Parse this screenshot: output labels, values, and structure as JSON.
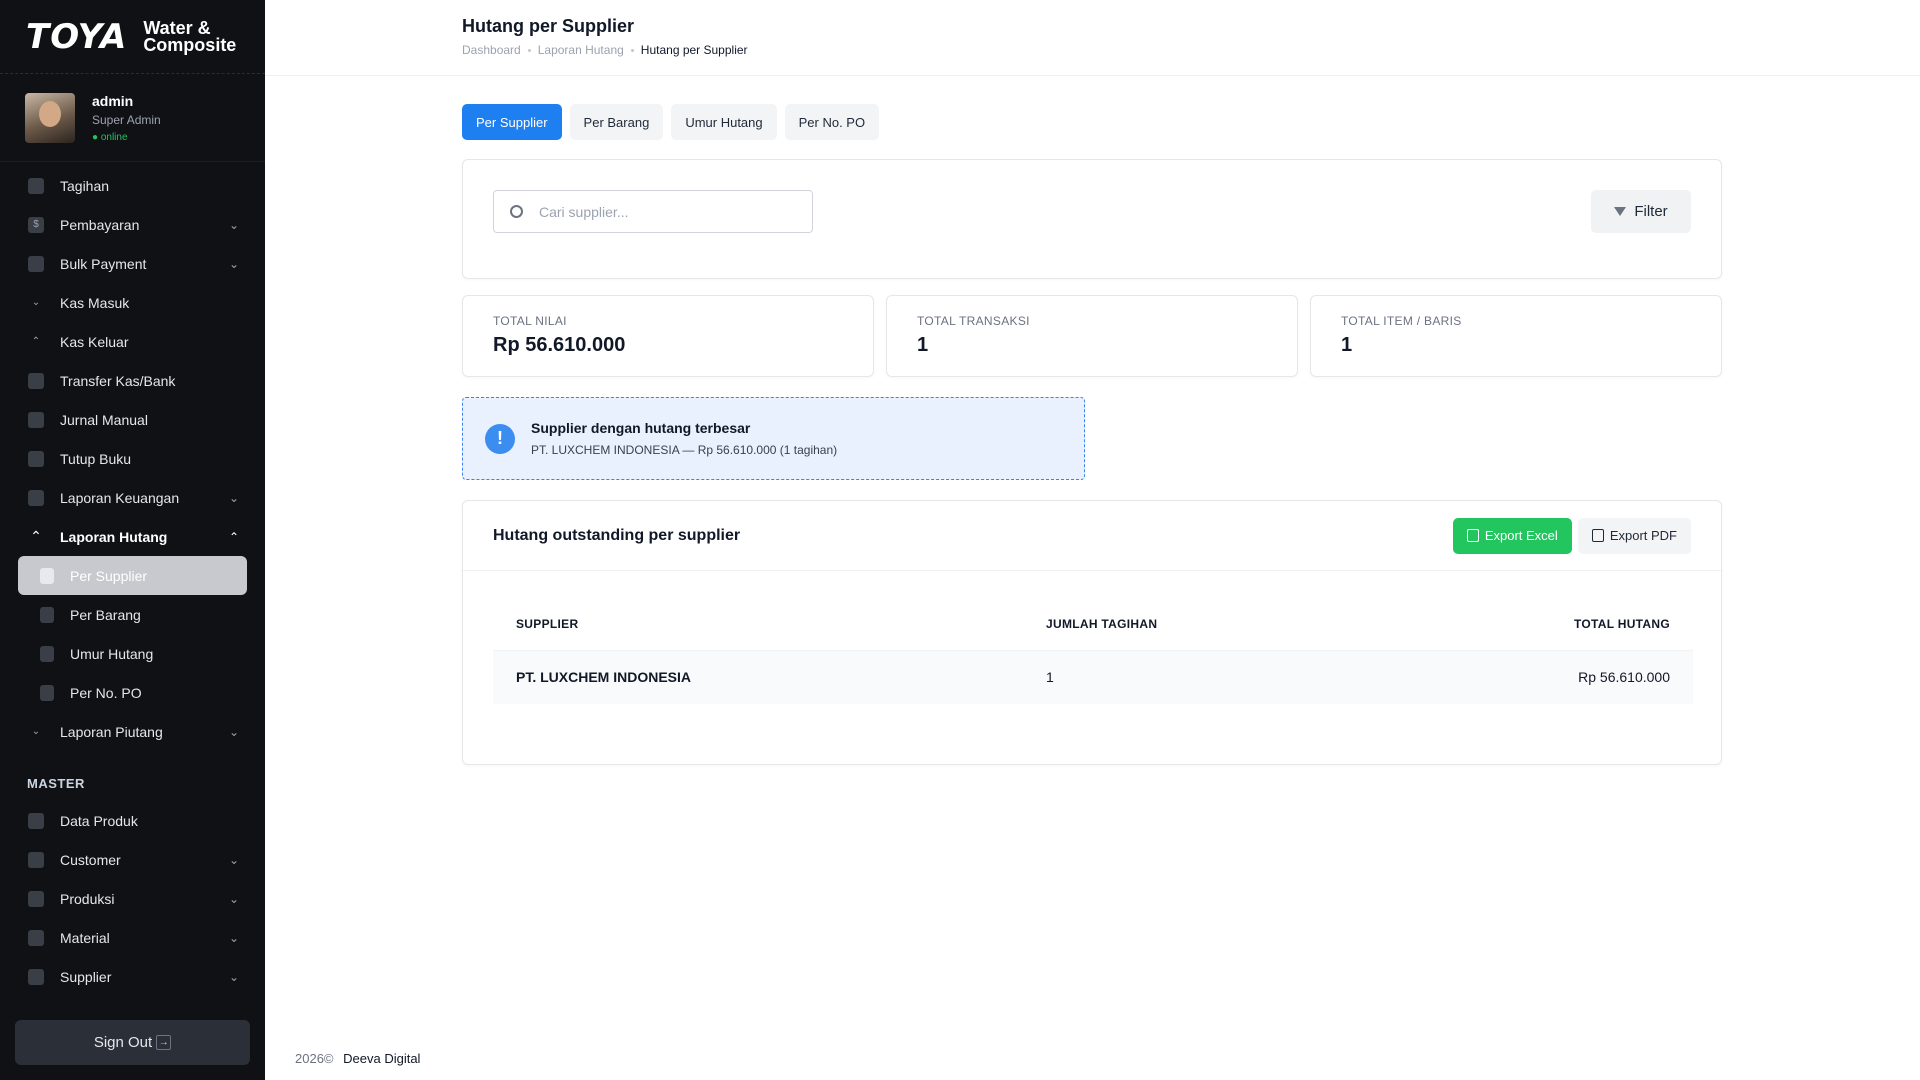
{
  "brand": {
    "logo": "TOYA",
    "line1": "Water &",
    "line2": "Composite"
  },
  "user": {
    "name": "admin",
    "role": "Super Admin",
    "status": "● online"
  },
  "sidebar": {
    "items": [
      {
        "label": "Tagihan",
        "chevron": ""
      },
      {
        "label": "Pembayaran",
        "chevron": "⌄"
      },
      {
        "label": "Bulk Payment",
        "chevron": "⌄"
      },
      {
        "label": "Kas Masuk",
        "chevron": ""
      },
      {
        "label": "Kas Keluar",
        "chevron": ""
      },
      {
        "label": "Transfer Kas/Bank",
        "chevron": ""
      },
      {
        "label": "Jurnal Manual",
        "chevron": ""
      },
      {
        "label": "Tutup Buku",
        "chevron": ""
      },
      {
        "label": "Laporan Keuangan",
        "chevron": "⌄"
      }
    ],
    "open_group": {
      "label": "Laporan Hutang",
      "chevron": "⌃"
    },
    "sub_items": [
      "Per Supplier",
      "Per Barang",
      "Umur Hutang",
      "Per No. PO"
    ],
    "after_items": [
      {
        "label": "Laporan Piutang",
        "chevron": "⌄"
      }
    ],
    "section_master": "MASTER",
    "master_items": [
      {
        "label": "Data Produk",
        "chevron": ""
      },
      {
        "label": "Customer",
        "chevron": "⌄"
      },
      {
        "label": "Produksi",
        "chevron": "⌄"
      },
      {
        "label": "Material",
        "chevron": "⌄"
      },
      {
        "label": "Supplier",
        "chevron": "⌄"
      }
    ],
    "sign_out": "Sign Out"
  },
  "header": {
    "title": "Hutang per Supplier",
    "breadcrumb": [
      "Dashboard",
      "Laporan Hutang",
      "Hutang per Supplier"
    ]
  },
  "tabs": [
    "Per Supplier",
    "Per Barang",
    "Umur Hutang",
    "Per No. PO"
  ],
  "search": {
    "placeholder": "Cari supplier...",
    "filter_label": "Filter"
  },
  "stats": [
    {
      "label": "TOTAL NILAI",
      "value": "Rp 56.610.000"
    },
    {
      "label": "TOTAL TRANSAKSI",
      "value": "1"
    },
    {
      "label": "TOTAL ITEM / BARIS",
      "value": "1"
    }
  ],
  "alert": {
    "icon": "!",
    "title": "Supplier dengan hutang terbesar",
    "desc": "PT. LUXCHEM INDONESIA — Rp 56.610.000 (1 tagihan)"
  },
  "table": {
    "title": "Hutang outstanding per supplier",
    "export_excel": "Export Excel",
    "export_pdf": "Export PDF",
    "columns": [
      "SUPPLIER",
      "JUMLAH TAGIHAN",
      "TOTAL HUTANG"
    ],
    "rows": [
      {
        "supplier": "PT. LUXCHEM INDONESIA",
        "count": "1",
        "total": "Rp 56.610.000"
      }
    ]
  },
  "footer": {
    "year": "2026©",
    "company": "Deeva Digital"
  },
  "colors": {
    "primary": "#1e7ff0",
    "success": "#22c55e",
    "sidebar": "#0f1115"
  }
}
